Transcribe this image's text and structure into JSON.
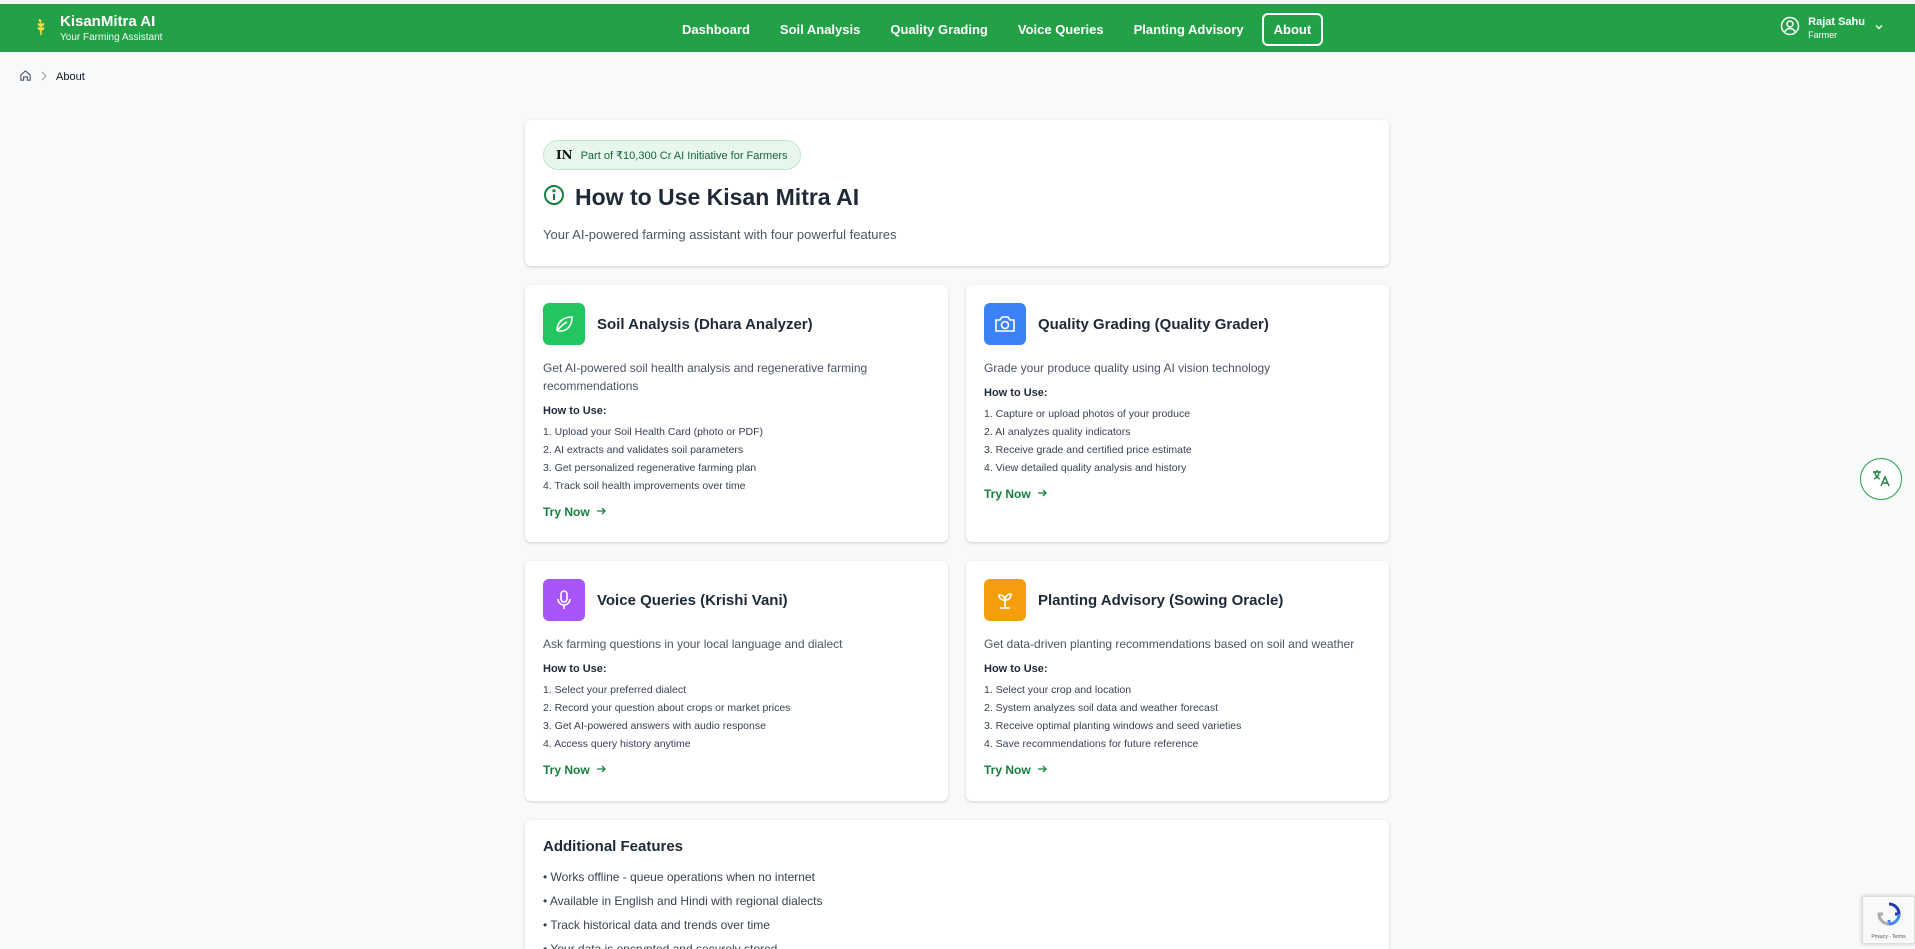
{
  "brand": {
    "name": "KisanMitra AI",
    "tagline": "Your Farming Assistant"
  },
  "nav": [
    {
      "label": "Dashboard"
    },
    {
      "label": "Soil Analysis"
    },
    {
      "label": "Quality Grading"
    },
    {
      "label": "Voice Queries"
    },
    {
      "label": "Planting Advisory"
    },
    {
      "label": "About",
      "active": true
    }
  ],
  "user": {
    "name": "Rajat Sahu",
    "role": "Farmer"
  },
  "breadcrumb": {
    "current": "About"
  },
  "hero": {
    "badge_flag": "IN",
    "badge_text": "Part of ₹10,300 Cr AI Initiative for Farmers",
    "title": "How to Use Kisan Mitra AI",
    "subtitle": "Your AI-powered farming assistant with four powerful features"
  },
  "features": [
    {
      "icon": "leaf-icon",
      "color": "#22c55e",
      "title": "Soil Analysis (Dhara Analyzer)",
      "desc": "Get AI-powered soil health analysis and regenerative farming recommendations",
      "how_label": "How to Use:",
      "steps": [
        "1. Upload your Soil Health Card (photo or PDF)",
        "2. AI extracts and validates soil parameters",
        "3. Get personalized regenerative farming plan",
        "4. Track soil health improvements over time"
      ],
      "cta": "Try Now"
    },
    {
      "icon": "camera-icon",
      "color": "#3b82f6",
      "title": "Quality Grading (Quality Grader)",
      "desc": "Grade your produce quality using AI vision technology",
      "how_label": "How to Use:",
      "steps": [
        "1. Capture or upload photos of your produce",
        "2. AI analyzes quality indicators",
        "3. Receive grade and certified price estimate",
        "4. View detailed quality analysis and history"
      ],
      "cta": "Try Now"
    },
    {
      "icon": "microphone-icon",
      "color": "#a855f7",
      "title": "Voice Queries (Krishi Vani)",
      "desc": "Ask farming questions in your local language and dialect",
      "how_label": "How to Use:",
      "steps": [
        "1. Select your preferred dialect",
        "2. Record your question about crops or market prices",
        "3. Get AI-powered answers with audio response",
        "4. Access query history anytime"
      ],
      "cta": "Try Now"
    },
    {
      "icon": "sprout-icon",
      "color": "#f59e0b",
      "title": "Planting Advisory (Sowing Oracle)",
      "desc": "Get data-driven planting recommendations based on soil and weather",
      "how_label": "How to Use:",
      "steps": [
        "1. Select your crop and location",
        "2. System analyzes soil data and weather forecast",
        "3. Receive optimal planting windows and seed varieties",
        "4. Save recommendations for future reference"
      ],
      "cta": "Try Now"
    }
  ],
  "additional": {
    "title": "Additional Features",
    "items": [
      "• Works offline - queue operations when no internet",
      "• Available in English and Hindi with regional dialects",
      "• Track historical data and trends over time",
      "• Your data is encrypted and securely stored"
    ]
  },
  "recaptcha": {
    "text": "Privacy - Terms"
  },
  "colors": {
    "primary": "#22a147",
    "link": "#15803d"
  }
}
